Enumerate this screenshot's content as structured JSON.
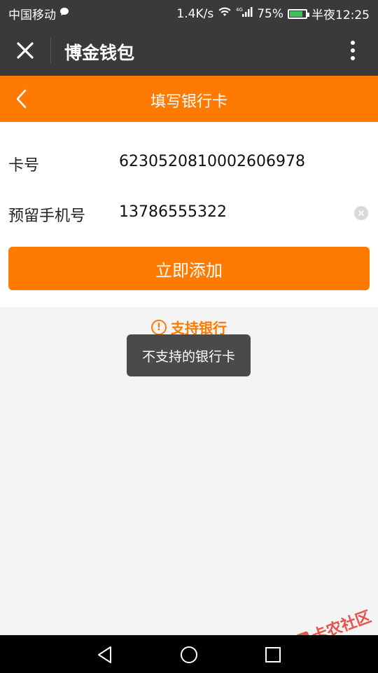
{
  "status_bar": {
    "carrier": "中国移动",
    "speed": "1.4K/s",
    "network": "4G",
    "battery": "75%",
    "battery_level": 0.75,
    "time": "半夜12:25"
  },
  "app_header": {
    "title": "博金钱包"
  },
  "nav_bar": {
    "title": "填写银行卡"
  },
  "form": {
    "card_label": "卡号",
    "card_number": "6230520810002606978",
    "phone_label": "预留手机号",
    "phone_number": "13786555322",
    "submit_label": "立即添加"
  },
  "support_link": {
    "label": "支持银行"
  },
  "toast": {
    "message": "不支持的银行卡"
  },
  "watermark": {
    "text": "卡农社区"
  },
  "colors": {
    "accent": "#ff7a00",
    "header_bg": "#3a3a3c",
    "page_bg": "#f4f4f4"
  }
}
